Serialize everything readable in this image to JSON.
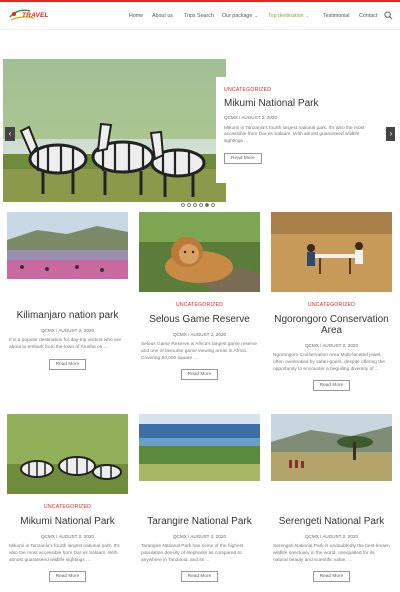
{
  "logo": {
    "text": "TRAVEL"
  },
  "nav": {
    "items": [
      {
        "label": "Home",
        "active": false,
        "dropdown": false
      },
      {
        "label": "About us",
        "active": false,
        "dropdown": false
      },
      {
        "label": "Trips Search",
        "active": false,
        "dropdown": false
      },
      {
        "label": "Our package",
        "active": false,
        "dropdown": true
      },
      {
        "label": "Top destination",
        "active": true,
        "dropdown": true
      },
      {
        "label": "Testimonial",
        "active": false,
        "dropdown": false
      },
      {
        "label": "Contact",
        "active": false,
        "dropdown": false
      }
    ],
    "search_icon": "search-icon"
  },
  "slider": {
    "category": "UNCATEGORIZED",
    "title": "Mikumi National Park",
    "meta": "QCMX  /  AUGUST 2, 2020",
    "excerpt": "Mikumi is Tanzania's fourth largest national park. It's also the most accessible from Dar es Salaam. With almost guaranteed wildlife sightings ...",
    "button": "Read More",
    "prev_icon": "chevron-left-icon",
    "next_icon": "chevron-right-icon",
    "dots": 6,
    "active_dot": 5
  },
  "cards": [
    {
      "category": "",
      "title": "Kilimanjaro nation park",
      "meta": "QCMX  /  AUGUST 2, 2020",
      "excerpt": "It is a popular destination for day trip visitors who are about to embark from the town of Arusha on ...",
      "button": "Read More"
    },
    {
      "category": "UNCATEGORIZED",
      "title": "Selous Game Reserve",
      "meta": "QCMX  /  AUGUST 2, 2020",
      "excerpt": "Selous Game Reserve is Africa's largest game reserve and one of favourite game viewing areas in Africa. Covering 50,000 square ...",
      "button": "Read More"
    },
    {
      "category": "UNCATEGORIZED",
      "title": "Ngorongoro Conservation Area",
      "meta": "QCMX  /  AUGUST 2, 2020",
      "excerpt": "Ngorongoro Conservation Area Multi-faceted jewel, often overlooked by safari-goers, despite offering the opportunity to encounter a beguiling diversity of ...",
      "button": "Read More"
    },
    {
      "category": "UNCATEGORIZED",
      "title": "Mikumi National Park",
      "meta": "QCMX  /  AUGUST 2, 2020",
      "excerpt": "Mikumi is Tanzania's fourth largest national park. It's also the most accessible from Dar es Salaam. With almost guaranteed wildlife sightings ...",
      "button": "Read More"
    },
    {
      "category": "",
      "title": "Tarangire National Park",
      "meta": "QCMX  /  AUGUST 2, 2020",
      "excerpt": "Tarangire National Park has some of the highest population density of elephants as compared to anywhere in Tanzania, and its ...",
      "button": "Read More"
    },
    {
      "category": "",
      "title": "Serengeti National Park",
      "meta": "QCMX  /  AUGUST 2, 2020",
      "excerpt": "Serengeti National Park is undoubtedly the best-known wildlife sanctuary in the world, unequalled for its natural beauty and scientific value, ...",
      "button": "Read More"
    }
  ],
  "colors": {
    "accent": "#e8251f",
    "nav_active": "#7fae28"
  }
}
